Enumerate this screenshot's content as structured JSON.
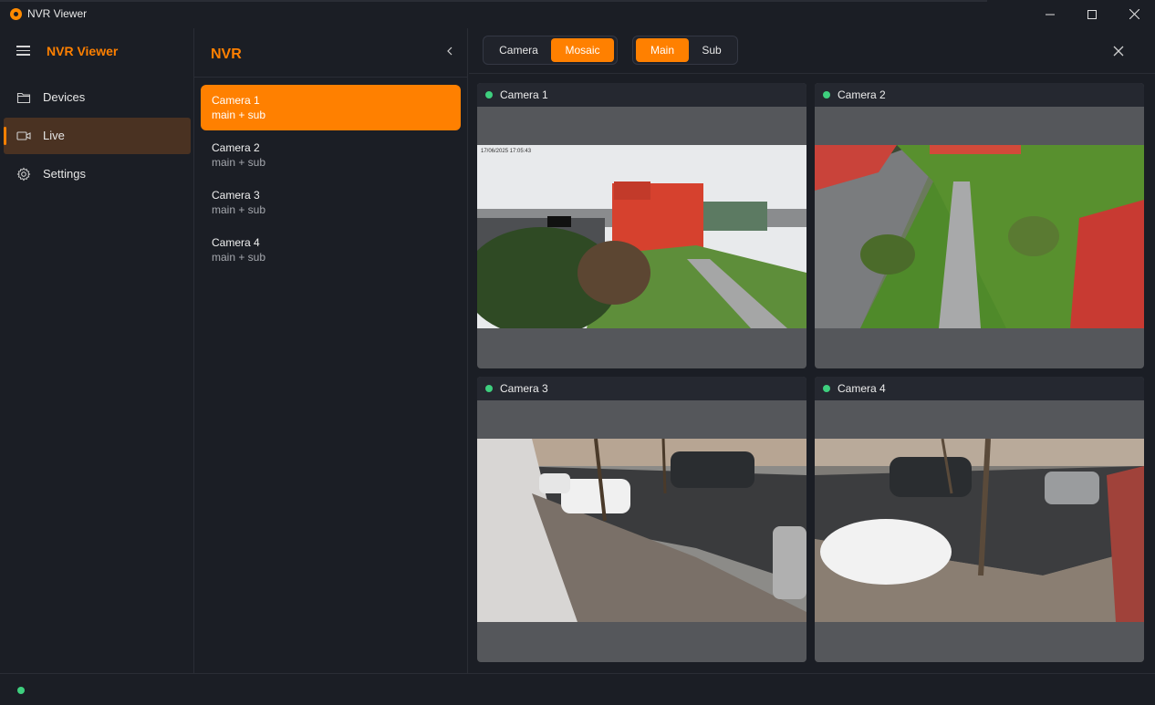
{
  "window": {
    "title": "NVR Viewer",
    "controls": {
      "minimize": "—",
      "maximize": "☐",
      "close": "✕"
    }
  },
  "nav": {
    "brand": "NVR Viewer",
    "items": [
      {
        "label": "Devices",
        "icon": "folder-icon",
        "active": false
      },
      {
        "label": "Live",
        "icon": "video-camera-icon",
        "active": true
      },
      {
        "label": "Settings",
        "icon": "gear-icon",
        "active": false
      }
    ]
  },
  "panel": {
    "title": "NVR",
    "cameras": [
      {
        "name": "Camera 1",
        "streams": "main + sub",
        "active": true
      },
      {
        "name": "Camera 2",
        "streams": "main + sub",
        "active": false
      },
      {
        "name": "Camera 3",
        "streams": "main + sub",
        "active": false
      },
      {
        "name": "Camera 4",
        "streams": "main + sub",
        "active": false
      }
    ]
  },
  "toolbar": {
    "view_mode": {
      "options": [
        "Camera",
        "Mosaic"
      ],
      "selected": "Mosaic"
    },
    "stream": {
      "options": [
        "Main",
        "Sub"
      ],
      "selected": "Main"
    }
  },
  "mosaic": {
    "tiles": [
      {
        "label": "Camera 1",
        "status": "online",
        "overlay_text": "17/06/2025 17:05:43"
      },
      {
        "label": "Camera 2",
        "status": "online"
      },
      {
        "label": "Camera 3",
        "status": "online"
      },
      {
        "label": "Camera 4",
        "status": "online"
      }
    ]
  },
  "colors": {
    "accent": "#ff8000",
    "background": "#1b1e25",
    "online": "#3ecf7e",
    "active_nav": "#4a3222"
  }
}
